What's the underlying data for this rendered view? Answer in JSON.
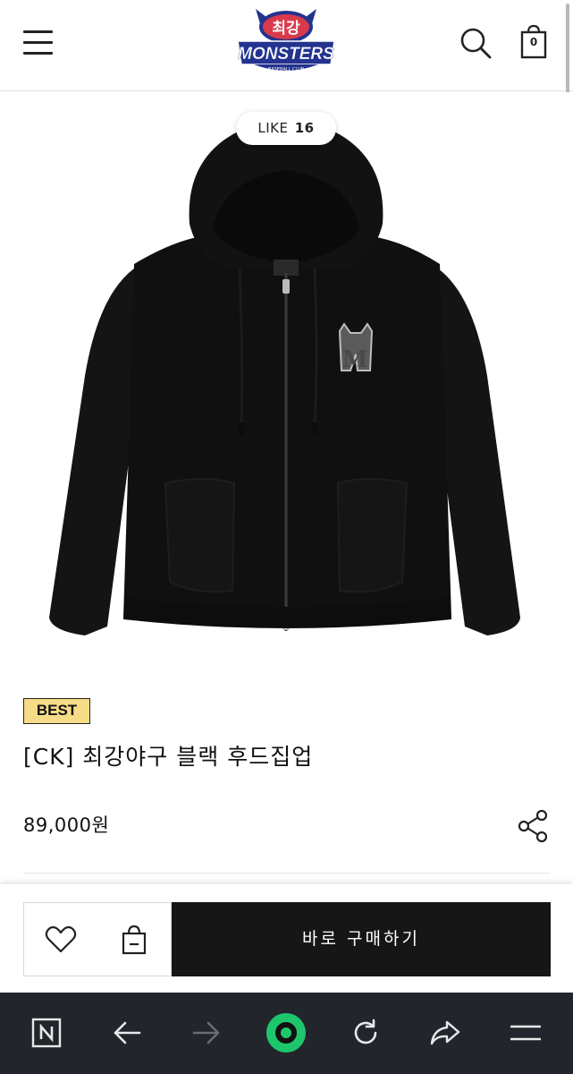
{
  "header": {
    "menu_icon": "hamburger-menu-icon",
    "logo": {
      "top_text": "최강",
      "main_text": "MONSTERS",
      "sub_text": "BASEBALL CLUB",
      "colors": {
        "primary": "#24338f",
        "accent": "#d93a4a",
        "outline": "#ffffff"
      }
    },
    "search_icon": "search-icon",
    "cart": {
      "icon": "shopping-bag-icon",
      "count": "0"
    }
  },
  "product": {
    "image_alt_icon": "black-zip-hoodie-image",
    "like": {
      "label": "LIKE",
      "count": "16"
    },
    "badge": "BEST",
    "title": "[CK] 최강야구 블랙 후드집업",
    "price": "89,000원",
    "share_icon": "share-icon"
  },
  "purchase_bar": {
    "wishlist_icon": "heart-icon",
    "add_to_cart_icon": "bag-icon",
    "buy_now_label": "바로 구매하기"
  },
  "browser_nav": {
    "items": [
      {
        "name": "naver-home",
        "icon": "n-square-icon"
      },
      {
        "name": "back",
        "icon": "arrow-left-icon"
      },
      {
        "name": "forward",
        "icon": "arrow-right-icon",
        "disabled": true
      },
      {
        "name": "home",
        "icon": "green-circle-icon"
      },
      {
        "name": "refresh",
        "icon": "refresh-icon"
      },
      {
        "name": "share",
        "icon": "share-arrow-icon"
      },
      {
        "name": "menu",
        "icon": "menu-icon"
      }
    ]
  },
  "colors": {
    "badge_bg": "#f6dc87",
    "buy_button_bg": "#161616",
    "browser_nav_bg": "#23252d",
    "home_green": "#1ec66b"
  }
}
